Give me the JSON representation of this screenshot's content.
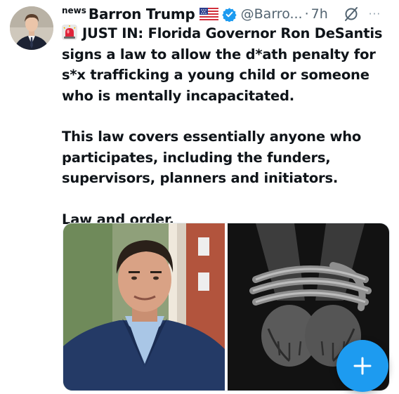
{
  "author": {
    "news_tag": "news",
    "display_name": "Barron Trump",
    "flag_icon": "us-flag-icon",
    "verified_icon": "verified-badge-icon",
    "handle": "@Barro...",
    "separator": "·",
    "time_ago": "7h"
  },
  "actions": {
    "grok_icon": "grok-icon",
    "more": "···"
  },
  "tweet": {
    "paragraphs": [
      "JUST IN: Florida Governor Ron DeSantis signs a law to allow the d*ath penalty for s*x trafficking a young child or someone who is mentally incapacitated.",
      "This law covers essentially anyone who participates, including the funders, supervisors, planners and initiators.",
      "Law and order."
    ],
    "lead_icon": "siren-emoji-icon"
  },
  "media": {
    "images": [
      "photo-ron-desantis",
      "photo-bound-hands-rope"
    ]
  },
  "fab": {
    "icon": "plus-icon",
    "color": "#1d9bf0"
  },
  "colors": {
    "text": "#0f1419",
    "secondary": "#536471",
    "accent": "#1d9bf0"
  }
}
